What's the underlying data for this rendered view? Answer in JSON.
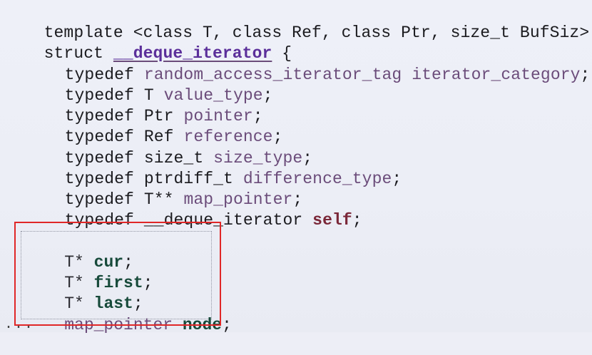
{
  "template_line": "template <class T, class Ref, class Ptr, size_t BufSiz>",
  "struct_line": {
    "keyword": "struct ",
    "name": "__deque_iterator",
    "brace": " {"
  },
  "typedefs": [
    {
      "keyword": "typedef ",
      "type": "random_access_iterator_tag",
      "name": " iterator_category",
      "end": ";"
    },
    {
      "keyword": "typedef ",
      "type": "T",
      "name": " value_type",
      "end": ";"
    },
    {
      "keyword": "typedef ",
      "type": "Ptr",
      "name": " pointer",
      "end": ";"
    },
    {
      "keyword": "typedef ",
      "type": "Ref",
      "name": " reference",
      "end": ";"
    },
    {
      "keyword": "typedef ",
      "type": "size_t",
      "name": " size_type",
      "end": ";"
    },
    {
      "keyword": "typedef ",
      "type": "ptrdiff_t",
      "name": " difference_type",
      "end": ";"
    },
    {
      "keyword": "typedef ",
      "type": "T**",
      "name": " map_pointer",
      "end": ";"
    },
    {
      "keyword": "typedef ",
      "type": "__deque_iterator",
      "name": " self",
      "end": ";"
    }
  ],
  "members": [
    {
      "type": "T* ",
      "name": "cur",
      "end": ";"
    },
    {
      "type": "T* ",
      "name": "first",
      "end": ";"
    },
    {
      "type": "T* ",
      "name": "last",
      "end": ";"
    },
    {
      "type": "map_pointer ",
      "name": "node",
      "end": ";"
    }
  ],
  "ellipsis": "..."
}
